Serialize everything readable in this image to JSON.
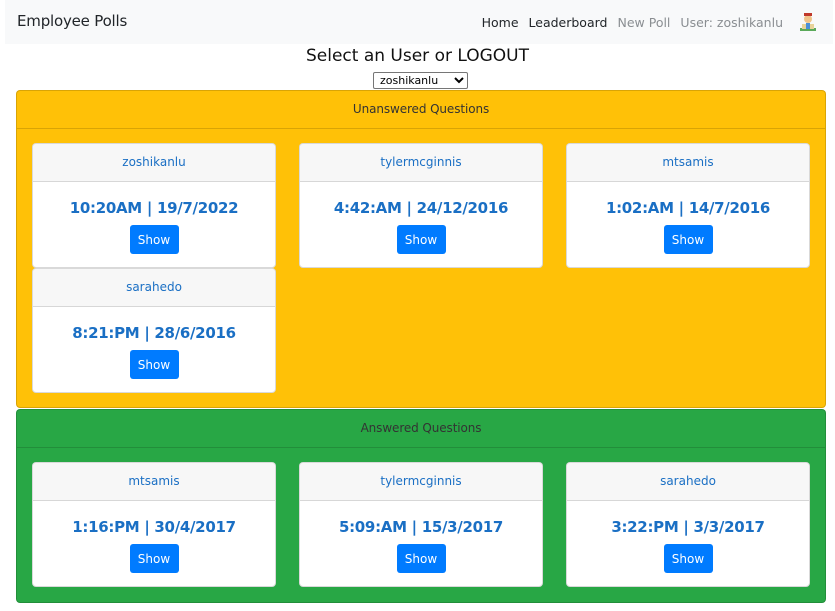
{
  "navbar": {
    "brand": "Employee Polls",
    "links": {
      "home": "Home",
      "leaderboard": "Leaderboard",
      "new_poll": "New Poll",
      "user": "User: zoshikanlu"
    }
  },
  "page": {
    "heading": "Select an User or LOGOUT",
    "user_select": {
      "value": "zoshikanlu"
    }
  },
  "unanswered": {
    "title": "Unanswered Questions",
    "cards": [
      {
        "author": "zoshikanlu",
        "time": "10:20AM | 19/7/2022",
        "button": "Show"
      },
      {
        "author": "tylermcginnis",
        "time": "4:42:AM | 24/12/2016",
        "button": "Show"
      },
      {
        "author": "mtsamis",
        "time": "1:02:AM | 14/7/2016",
        "button": "Show"
      },
      {
        "author": "sarahedo",
        "time": "8:21:PM | 28/6/2016",
        "button": "Show"
      }
    ]
  },
  "answered": {
    "title": "Answered Questions",
    "cards": [
      {
        "author": "mtsamis",
        "time": "1:16:PM | 30/4/2017",
        "button": "Show"
      },
      {
        "author": "tylermcginnis",
        "time": "5:09:AM | 15/3/2017",
        "button": "Show"
      },
      {
        "author": "sarahedo",
        "time": "3:22:PM | 3/3/2017",
        "button": "Show"
      }
    ]
  },
  "colors": {
    "unanswered_bg": "#ffc107",
    "answered_bg": "#28a745",
    "button": "#007bff",
    "link": "#1a6fc4"
  }
}
